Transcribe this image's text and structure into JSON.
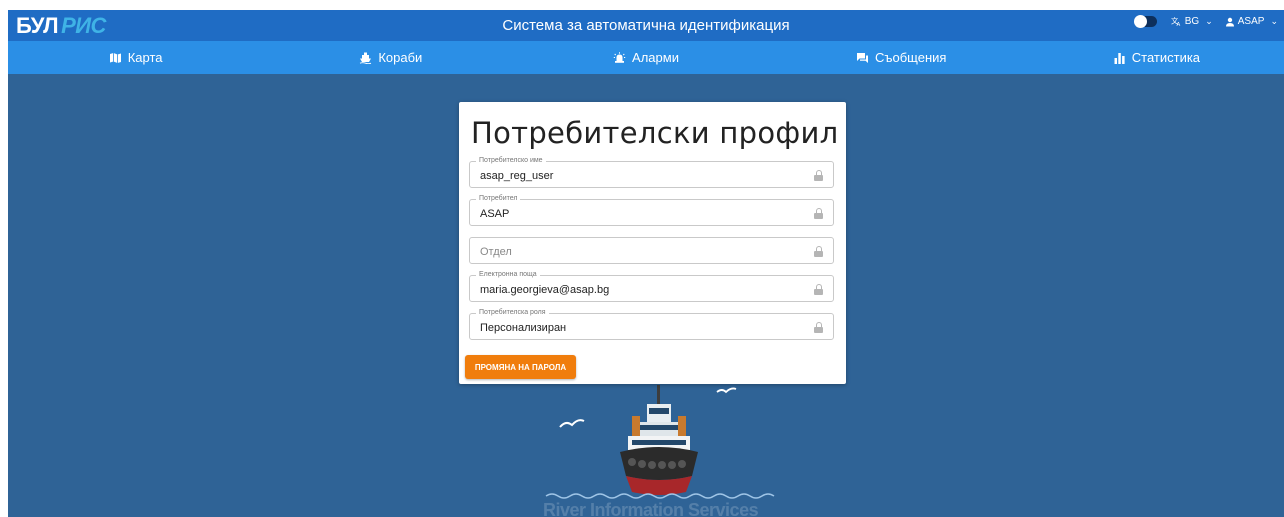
{
  "header": {
    "logo_part1": "БУЛ",
    "logo_part2": "РИС",
    "title": "Система за автоматична идентификация",
    "language": "BG",
    "user": "ASAP",
    "icons": [
      "toggle-switch",
      "translate-icon",
      "user-icon",
      "chevron-down-icon"
    ]
  },
  "nav": {
    "items": [
      {
        "label": "Карта",
        "icon": "map-icon"
      },
      {
        "label": "Кораби",
        "icon": "ship-icon"
      },
      {
        "label": "Аларми",
        "icon": "alarm-icon"
      },
      {
        "label": "Съобщения",
        "icon": "messages-icon"
      },
      {
        "label": "Статистика",
        "icon": "statistics-icon"
      }
    ]
  },
  "profile": {
    "title": "Потребителски профил",
    "fields": [
      {
        "label": "Потребителско име",
        "value": "asap_reg_user"
      },
      {
        "label": "Потребител",
        "value": "ASAP"
      },
      {
        "label": "",
        "placeholder": "Отдел",
        "value": ""
      },
      {
        "label": "Електронна поща",
        "value": "maria.georgieva@asap.bg"
      },
      {
        "label": "Потребителска роля",
        "value": "Персонализиран"
      }
    ],
    "change_password_label": "ПРОМЯНА НА ПАРОЛА"
  },
  "background": {
    "watermark": "River Information Services"
  },
  "colors": {
    "topbar": "#1f6cc4",
    "navbar": "#2b8fe6",
    "background": "#2f6396",
    "accent_button": "#f07d0c"
  }
}
